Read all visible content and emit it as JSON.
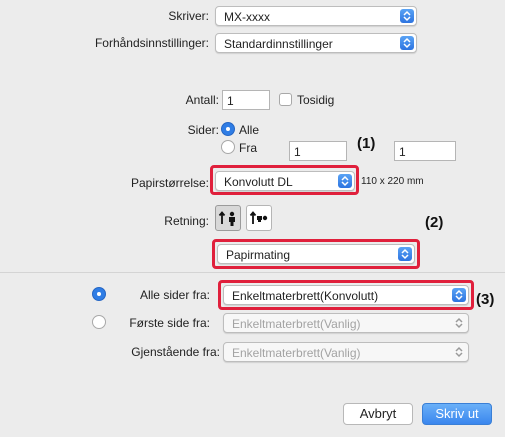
{
  "printer": {
    "label": "Skriver:",
    "value": "MX-xxxx"
  },
  "presets": {
    "label": "Forhåndsinnstillinger:",
    "value": "Standardinnstillinger"
  },
  "copies": {
    "label": "Antall:",
    "value": "1",
    "duplex_label": "Tosidig"
  },
  "pages": {
    "label": "Sider:",
    "all_label": "Alle",
    "from_label": "Fra",
    "from_value": "1",
    "to_value": "1"
  },
  "paper_size": {
    "label": "Papirstørrelse:",
    "value": "Konvolutt DL",
    "dimensions": "110 x 220 mm"
  },
  "orientation": {
    "label": "Retning:"
  },
  "section": {
    "value": "Papirmating"
  },
  "feed": {
    "all_pages_label": "Alle sider fra:",
    "all_pages_value": "Enkeltmaterbrett(Konvolutt)",
    "first_page_label": "Første side fra:",
    "first_page_value": "Enkeltmaterbrett(Vanlig)",
    "remaining_label": "Gjenstående fra:",
    "remaining_value": "Enkeltmaterbrett(Vanlig)"
  },
  "buttons": {
    "cancel": "Avbryt",
    "print": "Skriv ut"
  },
  "callouts": {
    "c1": "(1)",
    "c2": "(2)",
    "c3": "(3)"
  },
  "colors": {
    "accent": "#2f7de5",
    "highlight": "#e0203c",
    "background": "#ececec"
  }
}
